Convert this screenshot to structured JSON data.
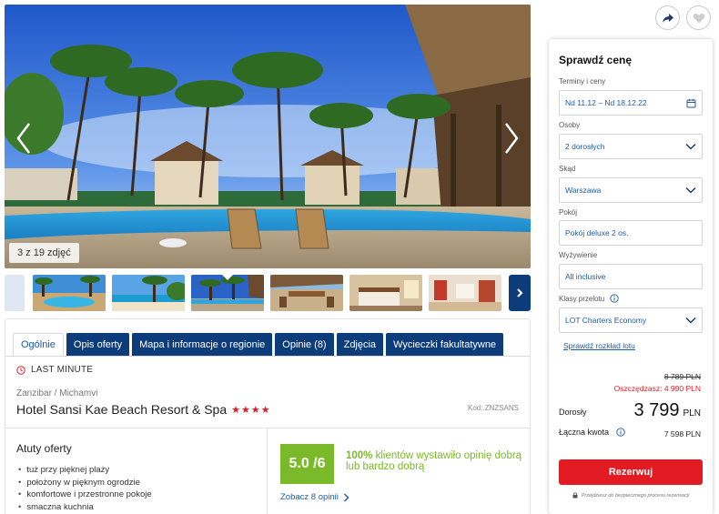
{
  "gallery": {
    "counter": "3 z 19 zdjęć"
  },
  "tabs": [
    {
      "label": "Ogólnie"
    },
    {
      "label": "Opis oferty"
    },
    {
      "label": "Mapa i informacje o regionie"
    },
    {
      "label": "Opinie (8)"
    },
    {
      "label": "Zdjęcia"
    },
    {
      "label": "Wycieczki fakultatywne"
    }
  ],
  "hotel": {
    "badge": "LAST MINUTE",
    "breadcrumb": "Zanzibar / Michamvi",
    "name": "Hotel Sansi Kae Beach Resort & Spa",
    "stars": "★★★★",
    "code": "Kod: ZNZSANS"
  },
  "highlights": {
    "title": "Atuty oferty",
    "items": [
      "tuż przy pięknej plaży",
      "położony w pięknym ogrodzie",
      "komfortowe i przestronne pokoje",
      "smaczna kuchnia"
    ]
  },
  "rating": {
    "score": "5.0 /6",
    "percent": "100%",
    "text": " klientów wystawiło opinię dobrą lub bardzo dobrą",
    "link": "Zobacz 8 opinii"
  },
  "panel": {
    "title": "Sprawdź cenę",
    "dates_label": "Terminy i ceny",
    "dates_value": "Nd 11.12 – Nd 18.12.22",
    "persons_label": "Osoby",
    "persons_value": "2 dorosłych",
    "from_label": "Skąd",
    "from_value": "Warszawa",
    "room_label": "Pokój",
    "room_value": "Pokój deluxe 2 os.",
    "board_label": "Wyżywienie",
    "board_value": "All inclusive",
    "class_label": "Klasy przelotu",
    "class_value": "LOT Charters Economy",
    "schedule_link": "Sprawdź rozkład lotu",
    "old_price": "8 789 PLN",
    "savings": "Oszczędzasz: 4 990 PLN",
    "adult_label": "Dorosły",
    "adult_price": "3 799",
    "currency": "PLN",
    "total_label": "Łączna kwota",
    "total_value": "7 598 PLN",
    "reserve": "Rezerwuj",
    "secure_note": "Przejdziesz do bezpiecznego procesu rezerwacji"
  },
  "colors": {
    "navy": "#0c3d7a",
    "link": "#1e5aa8",
    "red": "#e21b23",
    "green": "#7ab929"
  }
}
